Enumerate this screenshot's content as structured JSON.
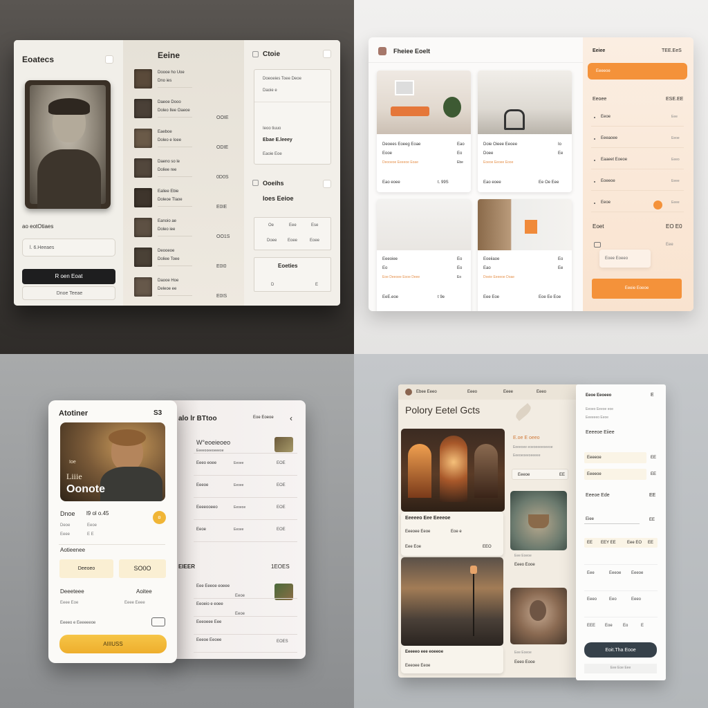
{
  "q1": {
    "profile": {
      "title": "Eoatecs",
      "caption": "ao eotOtiaes",
      "input_value": "l. 6.Heeaes",
      "primary_button": "R oen Eoat",
      "secondary_button": "Dnoe Teeae"
    },
    "list": {
      "title": "Eeine",
      "items": [
        {
          "title": "Doooe  ho  Uoe",
          "sub": "Dno  ies",
          "price": ""
        },
        {
          "title": "Daeoe Dooo",
          "sub": "Doleo Ilee Oaeoe",
          "price": "OOIE"
        },
        {
          "title": "Eaeboe",
          "sub": "Doleo  e  Ioee",
          "price": "ODIE"
        },
        {
          "title": "Daeno  so  le",
          "sub": "Doliee  ree",
          "price": "0D0S"
        },
        {
          "title": "Ealiee Ebie",
          "sub": "Doleoe Tlaoe",
          "price": "E0IE"
        },
        {
          "title": "Eanoio  ae",
          "sub": "Doleo  iee",
          "price": "OO1S"
        },
        {
          "title": "Deooeoe",
          "sub": "Doliee Toee",
          "price": "E0I0"
        },
        {
          "title": "Daooe  Hoe",
          "sub": "Deleoe  ee",
          "price": "E0IS"
        }
      ]
    },
    "right": {
      "title": "Ctoie",
      "box1": [
        "Doeoeies  Toee  Deoe",
        "Daoie  e",
        "Ieoo  tiuuo",
        "Ebae  E.leeey",
        "Eaoie  Eoe"
      ],
      "title2": "Ooeihs",
      "subtitle2": "Ioes Eeioe",
      "table_row1": [
        "Oe",
        "Eee",
        "Ese"
      ],
      "table_row2": [
        "Doee",
        "Eoee",
        "Eoee"
      ],
      "box2_title": "Eoeties",
      "box2_values": [
        "D",
        "E"
      ]
    }
  },
  "q2": {
    "header": {
      "title": "Fheiee Eoelt"
    },
    "cards": [
      {
        "title": "Deoees Eoeeg Eoae",
        "tag": "Eao",
        "sub": "Eooe",
        "tag2": "Eo",
        "link": "Deooeoe Eeeeoe Eoae",
        "link_meta": "Ebe",
        "footer_left": "Eao eoee",
        "footer_right": "t. 99S"
      },
      {
        "title": "Doie Oieee Eeoee",
        "tag": "Io",
        "sub": "Doee",
        "tag2": "Ee",
        "link": "Eoeoe Eeoee  Eooe",
        "link_meta": "",
        "footer_left": "Eao eoee",
        "footer_right": "Ee  Oe Eee"
      },
      {
        "title": "Eeeoiee",
        "tag": "Eo",
        "sub": "Eo",
        "tag2": "Eo",
        "link": "Eoe  Deeoee Eooe Deee",
        "link_meta": "Eo",
        "footer_left": "EeE.eoe",
        "footer_right": "t 9e"
      },
      {
        "title": "Eoeiiaoe",
        "tag": "Eo",
        "sub": "Eao",
        "tag2": "Ee",
        "link": "Doeie Eeeeoe  Doae",
        "link_meta": "",
        "footer_left": "Eee  Eoe",
        "footer_right": "Eoe  Ee Eoe"
      }
    ],
    "side": {
      "title": "Eeiee",
      "price": "TEE.EeS",
      "orange_button": "Eeeeoe",
      "label": "Eeoee",
      "label_value": "ESE.EE",
      "items": [
        {
          "label": "Eeoe",
          "value": "Eee"
        },
        {
          "label": "Eeeaoee",
          "value": "Eeoe"
        },
        {
          "label": "Eaaeet  Eoeoe",
          "value": "Eeeo"
        },
        {
          "label": "Eoeeoe",
          "value": "Eeee"
        },
        {
          "label": "Eeoe",
          "value": "Eeee"
        }
      ],
      "total_label": "Eoet",
      "total_value": "EO  E0",
      "note": "Eee",
      "input_value": "Eoee  Eoeeo",
      "button": "Eeeie  Eoeoe"
    }
  },
  "q3": {
    "phone": {
      "title": "Atotiner",
      "count": "S3",
      "hero_small": "Ioe",
      "hero_name": "Liiie",
      "hero_title": "Oonote",
      "stat_label": "Dnoe",
      "stat_value": "l9  ol o.45",
      "small_row": [
        "Deoe",
        "Eeoe",
        "Eeee",
        "E  E"
      ],
      "section": "Aotieenee",
      "chip1": "Deeoeo",
      "chip2": "SO0O",
      "row_label": "Deeeteee",
      "row_value": "Aoitee",
      "meta1": "Eeee  Eoe",
      "meta2": "Eeee  Eeee",
      "detail": "Eeeeo  e  Eeeeeeoe",
      "button": "AIIIUSS"
    },
    "back": {
      "title": "alo  lr  BTtoo",
      "action": "Eoe  Eoeoe",
      "rows": [
        {
          "title": "W°eoeieoeo",
          "sub": "Eeeeooeeoeeeoe",
          "price": ""
        },
        {
          "title": "Eeeo  eoee",
          "sub": "Eeoee",
          "price": "EOE"
        },
        {
          "title": "Eeeoe",
          "sub": "Eeoee",
          "price": "EOE"
        },
        {
          "title": "Eeeeooeeo",
          "sub": "Eeoeoe",
          "price": "EOE"
        },
        {
          "title": "Eeoe",
          "sub": "Eeoee",
          "price": "EOE"
        }
      ],
      "section": "EIEER",
      "section_value": "1EOES",
      "rows2": [
        {
          "title": "Eee  Eeeoe  eoeee",
          "price": "Eeoe"
        },
        {
          "title": "Eeoeio  e  eoee",
          "price": "Eeoe"
        },
        {
          "title": "Eeeoeee  Eee",
          "price": ""
        },
        {
          "title": "Eeeoe  Eeoee",
          "price": "EOES"
        }
      ]
    }
  },
  "q4": {
    "nav": [
      "Ebee  Eeeo",
      "Eeeo",
      "Eeee",
      "Eeeo"
    ],
    "title": "Polory Eetel Gcts",
    "feature_label": "E.oe  E  oeeo",
    "feature_lines": [
      "Eeeeoee  eoeoeeeeoeeoe",
      "Eeeoeoeeoeeeee"
    ],
    "feature_pill": "Eeeoe",
    "feature_pill_value": "EE",
    "card1": {
      "title": "Eeeeeo  Eee  Eeeeoe",
      "label": "Eeeoee  Eeoe",
      "value": "Eoe  e",
      "meta": "Eee  Eoe",
      "meta_value": "EEO"
    },
    "card2": {
      "lines": [
        "Eee  Eoeoe",
        "Eeeo  Eooe"
      ]
    },
    "card3": {
      "title": "Eeeeeo  eee  eoeeoe",
      "label": "Eeeoee  Eeoe",
      "meta": "Eee  Eeeee"
    },
    "card4": {
      "lines": [
        "Eee  Eoeoe",
        "Eeeo  Eooe"
      ]
    },
    "side": {
      "title": "Eeoe Eeoeeo",
      "action": "E",
      "lines": [
        "Eeoeo  Eeeoe  eoe",
        "Eeeeeeo  Eeoe"
      ],
      "section": "Eeeeoe  Eiiee",
      "chips": [
        [
          "Eeeeoe",
          "EE"
        ],
        [
          "Eeeeoe",
          "EE"
        ]
      ],
      "row_label": "Eeeoe  Ede",
      "row_value": "EE",
      "row2": "Eiee",
      "row2_value": "EE",
      "chips_row": [
        "EE",
        "EEY  EE",
        "Eee  EO",
        "EE"
      ],
      "grid": [
        [
          "Eee",
          "Eeeoe",
          "Eeeoe"
        ],
        [
          "Eeeo",
          "Eeo",
          "Eeeo"
        ],
        [
          "EEE",
          "Eoe",
          "Eo",
          "E"
        ]
      ],
      "button": "Eoit.Tha  Eooe",
      "footer": "Eee  Eoe  Eee"
    }
  },
  "colors": {
    "orange": "#f4923a",
    "yellow": "#f0b536",
    "dark_button": "#1e1e1f",
    "slate_button": "#36414a"
  }
}
